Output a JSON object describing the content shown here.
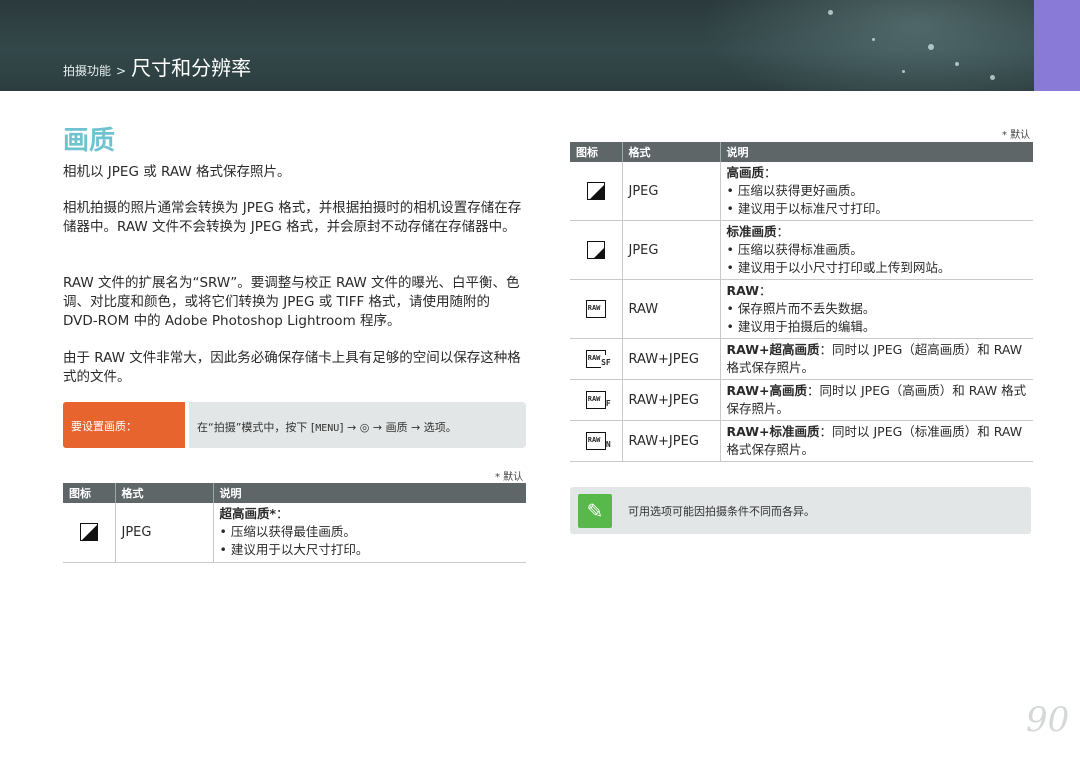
{
  "header": {
    "breadcrumb_parent": "拍摄功能",
    "breadcrumb_separator": ">",
    "breadcrumb_current": "尺寸和分辨率"
  },
  "section": {
    "title": "画质",
    "paragraphs": [
      "相机以 JPEG 或 RAW 格式保存照片。",
      "相机拍摄的照片通常会转换为 JPEG 格式，并根据拍摄时的相机设置存储在存储器中。RAW 文件不会转换为 JPEG 格式，并会原封不动存储在存储器中。",
      "RAW 文件的扩展名为“SRW”。要调整与校正 RAW 文件的曝光、白平衡、色调、对比度和颜色，或将它们转换为 JPEG 或 TIFF 格式，请使用随附的 DVD-ROM 中的 Adobe Photoshop Lightroom 程序。",
      "由于 RAW 文件非常大，因此务必确保存储卡上具有足够的空间以保存这种格式的文件。"
    ]
  },
  "tip": {
    "label": "要设置画质：",
    "text_prefix": "在“拍摄”模式中，按下 [",
    "menu_key": "MENU",
    "text_suffix": "] → ◎ → 画质 → 选项。"
  },
  "default_note": "* 默认",
  "table_headers": {
    "icon": "图标",
    "format": "格式",
    "desc": "说明"
  },
  "left_table": [
    {
      "icon": "superfine-quality-icon",
      "format": "JPEG",
      "heading": "超高画质*",
      "heading_tail": "：",
      "bullets": [
        "压缩以获得最佳画质。",
        "建议用于以大尺寸打印。"
      ]
    }
  ],
  "right_table": [
    {
      "icon": "fine-quality-icon",
      "format": "JPEG",
      "heading": "高画质",
      "heading_tail": "：",
      "bullets": [
        "压缩以获得更好画质。",
        "建议用于以标准尺寸打印。"
      ]
    },
    {
      "icon": "normal-quality-icon",
      "format": "JPEG",
      "heading": "标准画质",
      "heading_tail": "：",
      "bullets": [
        "压缩以获得标准画质。",
        "建议用于以小尺寸打印或上传到网站。"
      ]
    },
    {
      "icon": "raw-icon",
      "format": "RAW",
      "heading": "RAW",
      "heading_tail": "：",
      "bullets": [
        "保存照片而不丢失数据。",
        "建议用于拍摄后的编辑。"
      ]
    },
    {
      "icon": "raw-superfine-icon",
      "format": "RAW+JPEG",
      "heading": "RAW+超高画质",
      "heading_tail": "：同时以 JPEG（超高画质）和 RAW 格式保存照片。",
      "bullets": []
    },
    {
      "icon": "raw-fine-icon",
      "format": "RAW+JPEG",
      "heading": "RAW+高画质",
      "heading_tail": "：同时以 JPEG（高画质）和 RAW 格式保存照片。",
      "bullets": []
    },
    {
      "icon": "raw-normal-icon",
      "format": "RAW+JPEG",
      "heading": "RAW+标准画质",
      "heading_tail": "：同时以 JPEG（标准画质）和 RAW 格式保存照片。",
      "bullets": []
    }
  ],
  "note": {
    "icon": "pencil-note-icon",
    "text": "可用选项可能因拍摄条件不同而各异。"
  },
  "page_number": "90",
  "colors": {
    "title": "#6fc3d0",
    "tip_label": "#e8642e",
    "note_icon": "#57b94a",
    "table_header": "#5e6668",
    "side_tab": "#8a7ad8"
  }
}
